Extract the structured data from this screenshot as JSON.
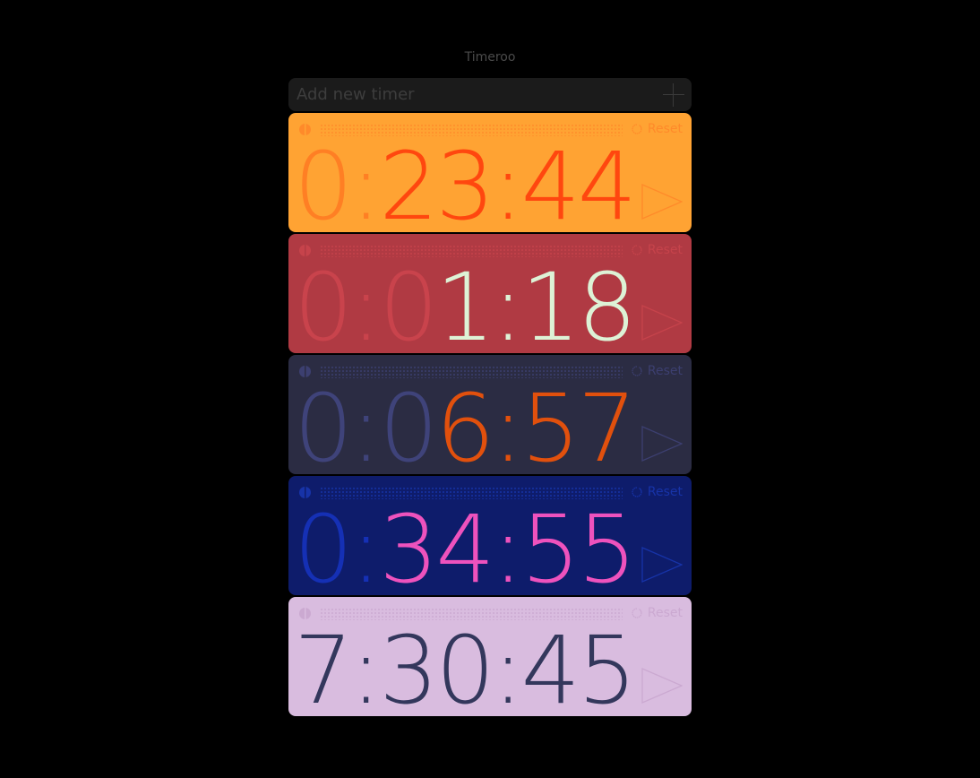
{
  "app": {
    "title": "Timeroo"
  },
  "add": {
    "placeholder": "Add new timer",
    "value": "",
    "button_icon": "plus-icon"
  },
  "timers": [
    {
      "time": "0:23:44",
      "dim_chars": 2,
      "bg": "#FFA333",
      "dim": "#FF7F24",
      "fg": "#FF470F",
      "ctrl": "#FF8A2A",
      "reset_label": "Reset"
    },
    {
      "time": "0:01:18",
      "dim_chars": 3,
      "bg": "#B03A43",
      "dim": "#C9434C",
      "fg": "#DDF2D6",
      "ctrl": "#C6434B",
      "reset_label": "Reset"
    },
    {
      "time": "0:06:57",
      "dim_chars": 3,
      "bg": "#2B2C43",
      "dim": "#3F437A",
      "fg": "#E1500D",
      "ctrl": "#3C3F70",
      "reset_label": "Reset"
    },
    {
      "time": "0:34:55",
      "dim_chars": 2,
      "bg": "#0E1C6B",
      "dim": "#1530B5",
      "fg": "#EE52BD",
      "ctrl": "#1733A8",
      "reset_label": "Reset"
    },
    {
      "time": "7:30:45",
      "dim_chars": 0,
      "bg": "#D9BCDF",
      "dim": "#C8A5CF",
      "fg": "#33375C",
      "ctrl": "#CBA9D1",
      "reset_label": "Reset"
    }
  ]
}
